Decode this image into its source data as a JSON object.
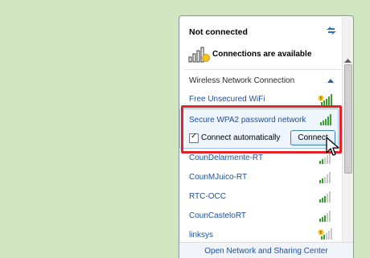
{
  "panel": {
    "status_title": "Not connected",
    "availability_text": "Connections are available",
    "section_title": "Wireless Network Connection"
  },
  "networks": [
    {
      "name": "Free Unsecured WiFi",
      "secured": false,
      "signal_bars": 5
    },
    {
      "name": "Secure WPA2 password network",
      "secured": true,
      "signal_bars": 5,
      "selected": true
    },
    {
      "name": "CounDelarmente-RT",
      "secured": true,
      "signal_bars": 2
    },
    {
      "name": "CounMJuico-RT",
      "secured": true,
      "signal_bars": 2
    },
    {
      "name": "RTC-OCC",
      "secured": true,
      "signal_bars": 3
    },
    {
      "name": "CounCasteloRT",
      "secured": true,
      "signal_bars": 3
    },
    {
      "name": "linksys",
      "secured": false,
      "signal_bars": 2
    }
  ],
  "selected_network": {
    "connect_automatically_label": "Connect automatically",
    "connect_automatically_checked": true,
    "connect_button_label": "Connect"
  },
  "footer": {
    "link_text": "Open Network and Sharing Center"
  },
  "colors": {
    "background": "#cfe6c0",
    "link": "#1b4f9c",
    "highlight": "#e0242a",
    "signal_on": "#3aa02f",
    "signal_off": "#c8c8c8"
  }
}
